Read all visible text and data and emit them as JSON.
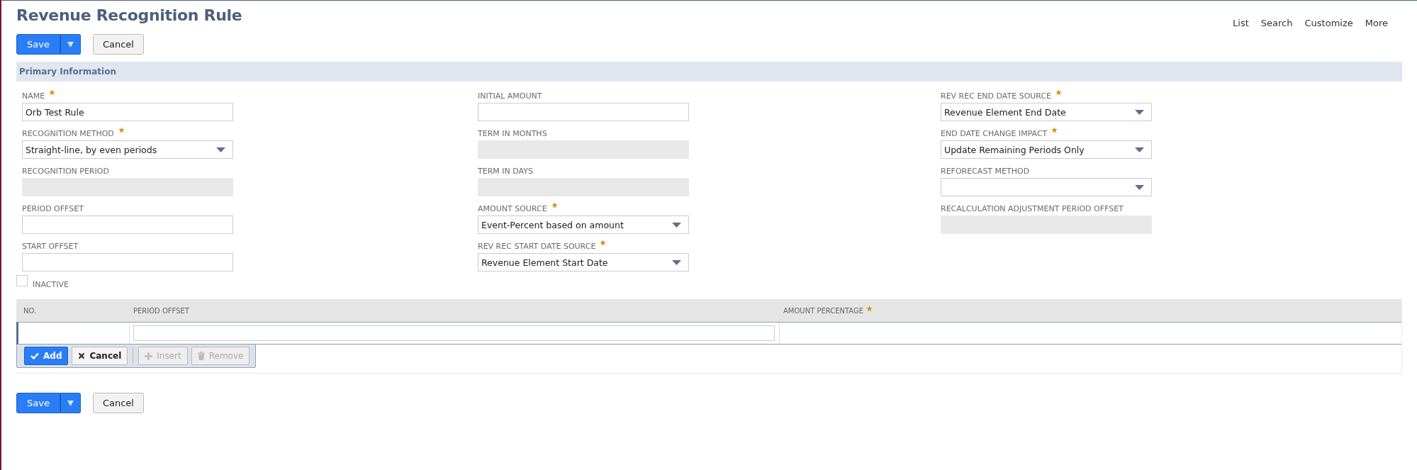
{
  "page": {
    "title": "Revenue Recognition Rule"
  },
  "top_links": [
    "List",
    "Search",
    "Customize",
    "More"
  ],
  "top_buttons": {
    "save": "Save",
    "cancel": "Cancel"
  },
  "section": {
    "title": "Primary Information"
  },
  "columns": [
    [
      {
        "label": "NAME",
        "required": true,
        "kind": "text",
        "value": "Orb Test Rule"
      },
      {
        "label": "RECOGNITION METHOD",
        "required": true,
        "kind": "select",
        "value": "Straight-line, by even periods"
      },
      {
        "label": "RECOGNITION PERIOD",
        "required": false,
        "kind": "disabled"
      },
      {
        "label": "PERIOD OFFSET",
        "required": false,
        "kind": "text"
      },
      {
        "label": "START OFFSET",
        "required": false,
        "kind": "text"
      }
    ],
    [
      {
        "label": "INITIAL AMOUNT",
        "required": false,
        "kind": "text"
      },
      {
        "label": "TERM IN MONTHS",
        "required": false,
        "kind": "disabled"
      },
      {
        "label": "TERM IN DAYS",
        "required": false,
        "kind": "disabled"
      },
      {
        "label": "AMOUNT SOURCE",
        "required": true,
        "kind": "select",
        "value": "Event-Percent based on amount"
      },
      {
        "label": "REV REC START DATE SOURCE",
        "required": true,
        "kind": "select",
        "value": "Revenue Element Start Date"
      }
    ],
    [
      {
        "label": "REV REC END DATE SOURCE",
        "required": true,
        "kind": "select",
        "value": "Revenue Element End Date"
      },
      {
        "label": "END DATE CHANGE IMPACT",
        "required": true,
        "kind": "select",
        "value": "Update Remaining Periods Only"
      },
      {
        "label": "REFORECAST METHOD",
        "required": false,
        "kind": "select"
      },
      {
        "label": "RECALCULATION ADJUSTMENT PERIOD OFFSET",
        "required": false,
        "kind": "disabled"
      }
    ]
  ],
  "inactive": {
    "label": "INACTIVE",
    "checked": false
  },
  "table": {
    "columns": [
      {
        "label": "NO.",
        "required": false
      },
      {
        "label": "PERIOD OFFSET",
        "required": false
      },
      {
        "label": "AMOUNT PERCENTAGE",
        "required": true
      }
    ],
    "row_buttons": [
      {
        "label": "Add",
        "kind": "add",
        "disabled": false
      },
      {
        "label": "Cancel",
        "kind": "cancel",
        "disabled": false
      },
      {
        "label": "Insert",
        "kind": "insert",
        "disabled": true
      },
      {
        "label": "Remove",
        "kind": "remove",
        "disabled": true
      }
    ]
  },
  "bottom_buttons": {
    "save": "Save",
    "cancel": "Cancel"
  }
}
